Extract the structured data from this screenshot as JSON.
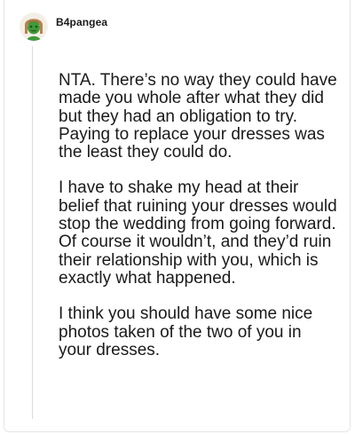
{
  "comment": {
    "username": "B4pangea",
    "avatar_icon": "frog-avatar-icon",
    "paragraphs": [
      "NTA. There’s no way they could have made you whole after what they did but they had an obligation to try. Paying to replace your dresses was the least they could do.",
      "I have to shake my head at their belief that ruining your dresses would stop the wedding from going forward. Of course it wouldn’t, and they’d ruin their relationship with you, which is exactly what happened.",
      "I think you should have some nice photos taken of the two of you in your dresses."
    ]
  },
  "colors": {
    "text": "#1a1a1a",
    "thread_line": "#dcdcdc",
    "avatar_background": "#f3efe6",
    "avatar_skin": "#3f9a3a",
    "avatar_hair": "#b9824f"
  }
}
